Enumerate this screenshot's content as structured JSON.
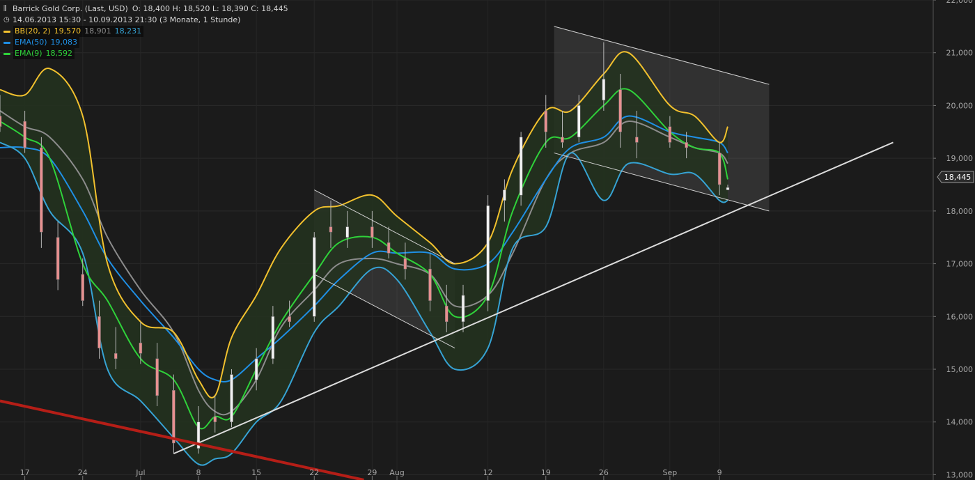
{
  "header": {
    "title": "Barrick Gold Corp. (Last, USD)",
    "ohlc": "O: 18,400   H: 18,520   L: 18,390   C: 18,445",
    "range": "14.06.2013 15:30 - 10.09.2013 21:30 (3 Monate, 1 Stunde)"
  },
  "indicators": [
    {
      "label": "BB(20, 2)",
      "values": [
        "19,570",
        "18,901",
        "18,231"
      ],
      "value_colors": [
        "#f2c12e",
        "#8c8c8c",
        "#36a3d4"
      ],
      "color": "#f2c12e"
    },
    {
      "label": "EMA(50)",
      "values": [
        "19,083"
      ],
      "value_colors": [
        "#1f8fe5"
      ],
      "color": "#1f8fe5"
    },
    {
      "label": "EMA(9)",
      "values": [
        "18,592"
      ],
      "value_colors": [
        "#2fd23a"
      ],
      "color": "#2fd23a"
    }
  ],
  "last_price_label": "18,445",
  "colors": {
    "background": "#1b1b1b",
    "bb_upper": "#f2c12e",
    "bb_mid": "#8c8c8c",
    "bb_lower": "#36a3d4",
    "ema50": "#1f8fe5",
    "ema9": "#2fd23a",
    "band_fill": "#23321e",
    "candle_up": "#f2f2f2",
    "candle_down": "#e89090",
    "trend_white": "#dcdcdc",
    "trend_red": "#b51e17"
  },
  "chart_data": {
    "type": "line",
    "ylim": [
      12.9,
      22.0
    ],
    "y_ticks": [
      "13,000",
      "14,000",
      "15,000",
      "16,000",
      "17,000",
      "18,000",
      "19,000",
      "20,000",
      "21,000",
      "22,000"
    ],
    "y_tick_values": [
      13,
      14,
      15,
      16,
      17,
      18,
      19,
      20,
      21,
      22
    ],
    "x_ticks": [
      "17",
      "24",
      "Jul",
      "8",
      "15",
      "22",
      "29",
      "Aug",
      "12",
      "19",
      "26",
      "Sep",
      "9"
    ],
    "x_tick_dates": [
      "2013-06-17",
      "2013-06-24",
      "2013-07-01",
      "2013-07-08",
      "2013-07-15",
      "2013-07-22",
      "2013-07-29",
      "2013-08-01",
      "2013-08-12",
      "2013-08-19",
      "2013-08-26",
      "2013-09-03",
      "2013-09-09"
    ],
    "series": [
      {
        "name": "BB(20, 2)",
        "dates": [
          "2013-06-14",
          "2013-06-17",
          "2013-06-20",
          "2013-06-24",
          "2013-06-27",
          "2013-07-01",
          "2013-07-05",
          "2013-07-08",
          "2013-07-10",
          "2013-07-12",
          "2013-07-15",
          "2013-07-18",
          "2013-07-22",
          "2013-07-25",
          "2013-07-29",
          "2013-08-01",
          "2013-08-05",
          "2013-08-08",
          "2013-08-12",
          "2013-08-15",
          "2013-08-19",
          "2013-08-22",
          "2013-08-26",
          "2013-08-29",
          "2013-09-03",
          "2013-09-06",
          "2013-09-09",
          "2013-09-10"
        ],
        "values": [
          20.3,
          20.2,
          20.7,
          19.8,
          17.0,
          15.9,
          15.7,
          14.8,
          14.5,
          15.6,
          16.4,
          17.3,
          18.0,
          18.1,
          18.3,
          17.9,
          17.4,
          17.0,
          17.4,
          18.8,
          19.9,
          19.9,
          20.6,
          21.0,
          20.0,
          19.8,
          19.3,
          19.6
        ]
      },
      {
        "name": "",
        "dates": [
          "2013-06-14",
          "2013-06-17",
          "2013-06-20",
          "2013-06-24",
          "2013-06-27",
          "2013-07-01",
          "2013-07-05",
          "2013-07-08",
          "2013-07-10",
          "2013-07-12",
          "2013-07-15",
          "2013-07-18",
          "2013-07-22",
          "2013-07-25",
          "2013-07-29",
          "2013-08-01",
          "2013-08-05",
          "2013-08-08",
          "2013-08-12",
          "2013-08-15",
          "2013-08-19",
          "2013-08-22",
          "2013-08-26",
          "2013-08-29",
          "2013-09-03",
          "2013-09-06",
          "2013-09-09",
          "2013-09-10"
        ],
        "values": [
          19.9,
          19.6,
          19.4,
          18.6,
          17.5,
          16.5,
          15.7,
          14.6,
          14.2,
          14.2,
          14.8,
          15.8,
          16.5,
          17.0,
          17.1,
          17.0,
          16.8,
          16.2,
          16.4,
          17.2,
          18.6,
          19.1,
          19.3,
          19.7,
          19.4,
          19.2,
          19.1,
          18.9
        ]
      },
      {
        "name": "",
        "dates": [
          "2013-06-14",
          "2013-06-17",
          "2013-06-20",
          "2013-06-24",
          "2013-06-27",
          "2013-07-01",
          "2013-07-05",
          "2013-07-08",
          "2013-07-10",
          "2013-07-12",
          "2013-07-15",
          "2013-07-18",
          "2013-07-22",
          "2013-07-25",
          "2013-07-29",
          "2013-08-01",
          "2013-08-05",
          "2013-08-08",
          "2013-08-12",
          "2013-08-15",
          "2013-08-19",
          "2013-08-22",
          "2013-08-26",
          "2013-08-29",
          "2013-09-03",
          "2013-09-06",
          "2013-09-09",
          "2013-09-10"
        ],
        "values": [
          19.3,
          19.0,
          18.0,
          17.2,
          15.0,
          14.4,
          13.7,
          13.2,
          13.3,
          13.4,
          14.0,
          14.4,
          15.7,
          16.2,
          16.9,
          16.7,
          15.7,
          15.0,
          15.4,
          17.3,
          17.7,
          19.1,
          18.2,
          18.9,
          18.7,
          18.7,
          18.2,
          18.2
        ]
      },
      {
        "name": "EMA(50)",
        "dates": [
          "2013-06-14",
          "2013-06-17",
          "2013-06-20",
          "2013-06-24",
          "2013-06-27",
          "2013-07-01",
          "2013-07-05",
          "2013-07-08",
          "2013-07-10",
          "2013-07-12",
          "2013-07-15",
          "2013-07-18",
          "2013-07-22",
          "2013-07-25",
          "2013-07-29",
          "2013-08-01",
          "2013-08-05",
          "2013-08-08",
          "2013-08-12",
          "2013-08-15",
          "2013-08-19",
          "2013-08-22",
          "2013-08-26",
          "2013-08-29",
          "2013-09-03",
          "2013-09-06",
          "2013-09-09",
          "2013-09-10"
        ],
        "values": [
          19.2,
          19.2,
          19.0,
          18.0,
          17.1,
          16.3,
          15.6,
          15.0,
          14.8,
          14.8,
          15.2,
          15.6,
          16.2,
          16.7,
          17.2,
          17.2,
          17.2,
          16.9,
          17.0,
          17.6,
          18.6,
          19.2,
          19.4,
          19.8,
          19.5,
          19.4,
          19.3,
          19.1
        ]
      },
      {
        "name": "EMA(9)",
        "dates": [
          "2013-06-14",
          "2013-06-17",
          "2013-06-20",
          "2013-06-24",
          "2013-06-27",
          "2013-07-01",
          "2013-07-05",
          "2013-07-08",
          "2013-07-10",
          "2013-07-12",
          "2013-07-15",
          "2013-07-18",
          "2013-07-22",
          "2013-07-25",
          "2013-07-29",
          "2013-08-01",
          "2013-08-05",
          "2013-08-08",
          "2013-08-12",
          "2013-08-15",
          "2013-08-19",
          "2013-08-22",
          "2013-08-26",
          "2013-08-29",
          "2013-09-03",
          "2013-09-06",
          "2013-09-09",
          "2013-09-10"
        ],
        "values": [
          19.7,
          19.4,
          19.0,
          17.0,
          16.3,
          15.2,
          14.8,
          13.9,
          14.1,
          14.1,
          15.0,
          15.9,
          16.8,
          17.4,
          17.5,
          17.2,
          16.8,
          16.0,
          16.4,
          18.0,
          19.3,
          19.4,
          20.0,
          20.3,
          19.5,
          19.2,
          19.1,
          18.6
        ]
      }
    ],
    "candles": {
      "dates": [
        "2013-06-14",
        "2013-06-17",
        "2013-06-19",
        "2013-06-21",
        "2013-06-24",
        "2013-06-26",
        "2013-06-28",
        "2013-07-01",
        "2013-07-03",
        "2013-07-05",
        "2013-07-08",
        "2013-07-10",
        "2013-07-12",
        "2013-07-15",
        "2013-07-17",
        "2013-07-19",
        "2013-07-22",
        "2013-07-24",
        "2013-07-26",
        "2013-07-29",
        "2013-07-31",
        "2013-08-02",
        "2013-08-05",
        "2013-08-07",
        "2013-08-09",
        "2013-08-12",
        "2013-08-14",
        "2013-08-16",
        "2013-08-19",
        "2013-08-21",
        "2013-08-23",
        "2013-08-26",
        "2013-08-28",
        "2013-08-30",
        "2013-09-03",
        "2013-09-05",
        "2013-09-09",
        "2013-09-10"
      ],
      "open": [
        19.8,
        19.7,
        19.2,
        17.5,
        16.8,
        16.0,
        15.3,
        15.5,
        15.2,
        14.6,
        13.5,
        14.1,
        14.0,
        14.8,
        15.2,
        16.0,
        16.0,
        17.7,
        17.5,
        17.7,
        17.4,
        17.1,
        16.9,
        16.2,
        15.9,
        16.3,
        18.2,
        18.3,
        19.9,
        19.4,
        19.4,
        20.1,
        20.3,
        19.4,
        19.6,
        19.3,
        19.1,
        18.4
      ],
      "high": [
        20.2,
        19.9,
        19.4,
        17.8,
        17.1,
        16.3,
        15.8,
        15.9,
        15.5,
        14.9,
        14.3,
        14.5,
        15.0,
        15.4,
        16.2,
        16.3,
        17.6,
        18.2,
        18.0,
        18.0,
        17.7,
        17.4,
        17.2,
        16.6,
        16.6,
        18.3,
        18.6,
        19.5,
        20.2,
        19.9,
        20.2,
        21.2,
        20.6,
        19.9,
        19.8,
        19.5,
        19.3,
        18.5
      ],
      "low": [
        19.5,
        19.1,
        17.3,
        16.5,
        16.2,
        15.2,
        15.0,
        15.1,
        14.3,
        13.4,
        13.4,
        13.8,
        13.9,
        14.6,
        15.1,
        15.8,
        15.9,
        17.3,
        17.3,
        17.3,
        17.1,
        16.7,
        16.1,
        15.7,
        15.7,
        16.1,
        17.8,
        18.1,
        19.2,
        19.2,
        19.3,
        19.9,
        19.2,
        19.0,
        19.2,
        19.0,
        18.3,
        18.4
      ],
      "close": [
        19.6,
        19.2,
        17.6,
        16.7,
        16.3,
        15.4,
        15.2,
        15.3,
        14.5,
        13.6,
        14.0,
        14.0,
        14.9,
        15.2,
        16.0,
        15.9,
        17.5,
        17.6,
        17.7,
        17.5,
        17.2,
        16.9,
        16.3,
        15.9,
        16.4,
        18.1,
        18.4,
        19.4,
        19.5,
        19.3,
        20.0,
        20.5,
        19.5,
        19.3,
        19.3,
        19.2,
        18.5,
        18.445
      ]
    },
    "channel_lines": [
      {
        "name": "",
        "dates": [
          "2013-07-22",
          "2013-08-08"
        ],
        "values": [
          18.4,
          17.0
        ]
      },
      {
        "name": "",
        "dates": [
          "2013-07-22",
          "2013-08-08"
        ],
        "values": [
          16.8,
          15.4
        ]
      },
      {
        "name": "",
        "dates": [
          "2013-08-20",
          "2013-09-15"
        ],
        "values": [
          21.5,
          20.4
        ]
      },
      {
        "name": "",
        "dates": [
          "2013-08-20",
          "2013-09-15"
        ],
        "values": [
          19.1,
          18.0
        ]
      }
    ],
    "trend_lines": [
      {
        "name": "",
        "dates": [
          "2013-07-05",
          "2013-09-30"
        ],
        "values": [
          13.4,
          19.3
        ]
      },
      {
        "name": "",
        "dates": [
          "2013-06-14",
          "2013-07-28"
        ],
        "values": [
          14.4,
          12.9
        ]
      }
    ]
  }
}
